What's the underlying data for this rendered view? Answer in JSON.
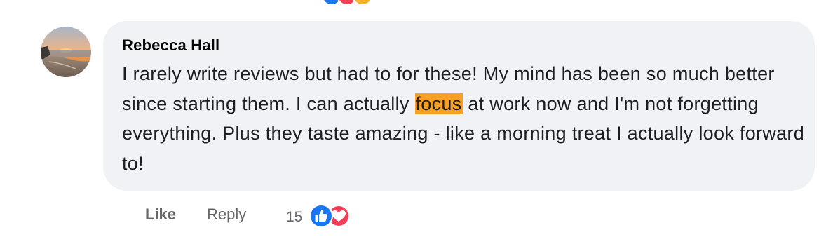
{
  "comment": {
    "author": "Rebecca Hall",
    "text_before": "I rarely write reviews but had to for these! My mind has been so much better since starting them. I can actually ",
    "text_highlight": "focus",
    "text_after": " at work now and I'm not forgetting everything. Plus they taste amazing - like a morning treat I actually look forward to!",
    "avatar_icon": "beach-sunset-avatar"
  },
  "actions": {
    "like_label": "Like",
    "reply_label": "Reply",
    "reaction_count": "15",
    "reaction_icons": [
      "like-reaction-icon",
      "love-reaction-icon"
    ]
  },
  "colors": {
    "bubble_bg": "#f0f2f5",
    "highlight": "#f7a024",
    "like_blue": "#1877f2",
    "love_red": "#f33e58",
    "muted_text": "#65676b"
  }
}
